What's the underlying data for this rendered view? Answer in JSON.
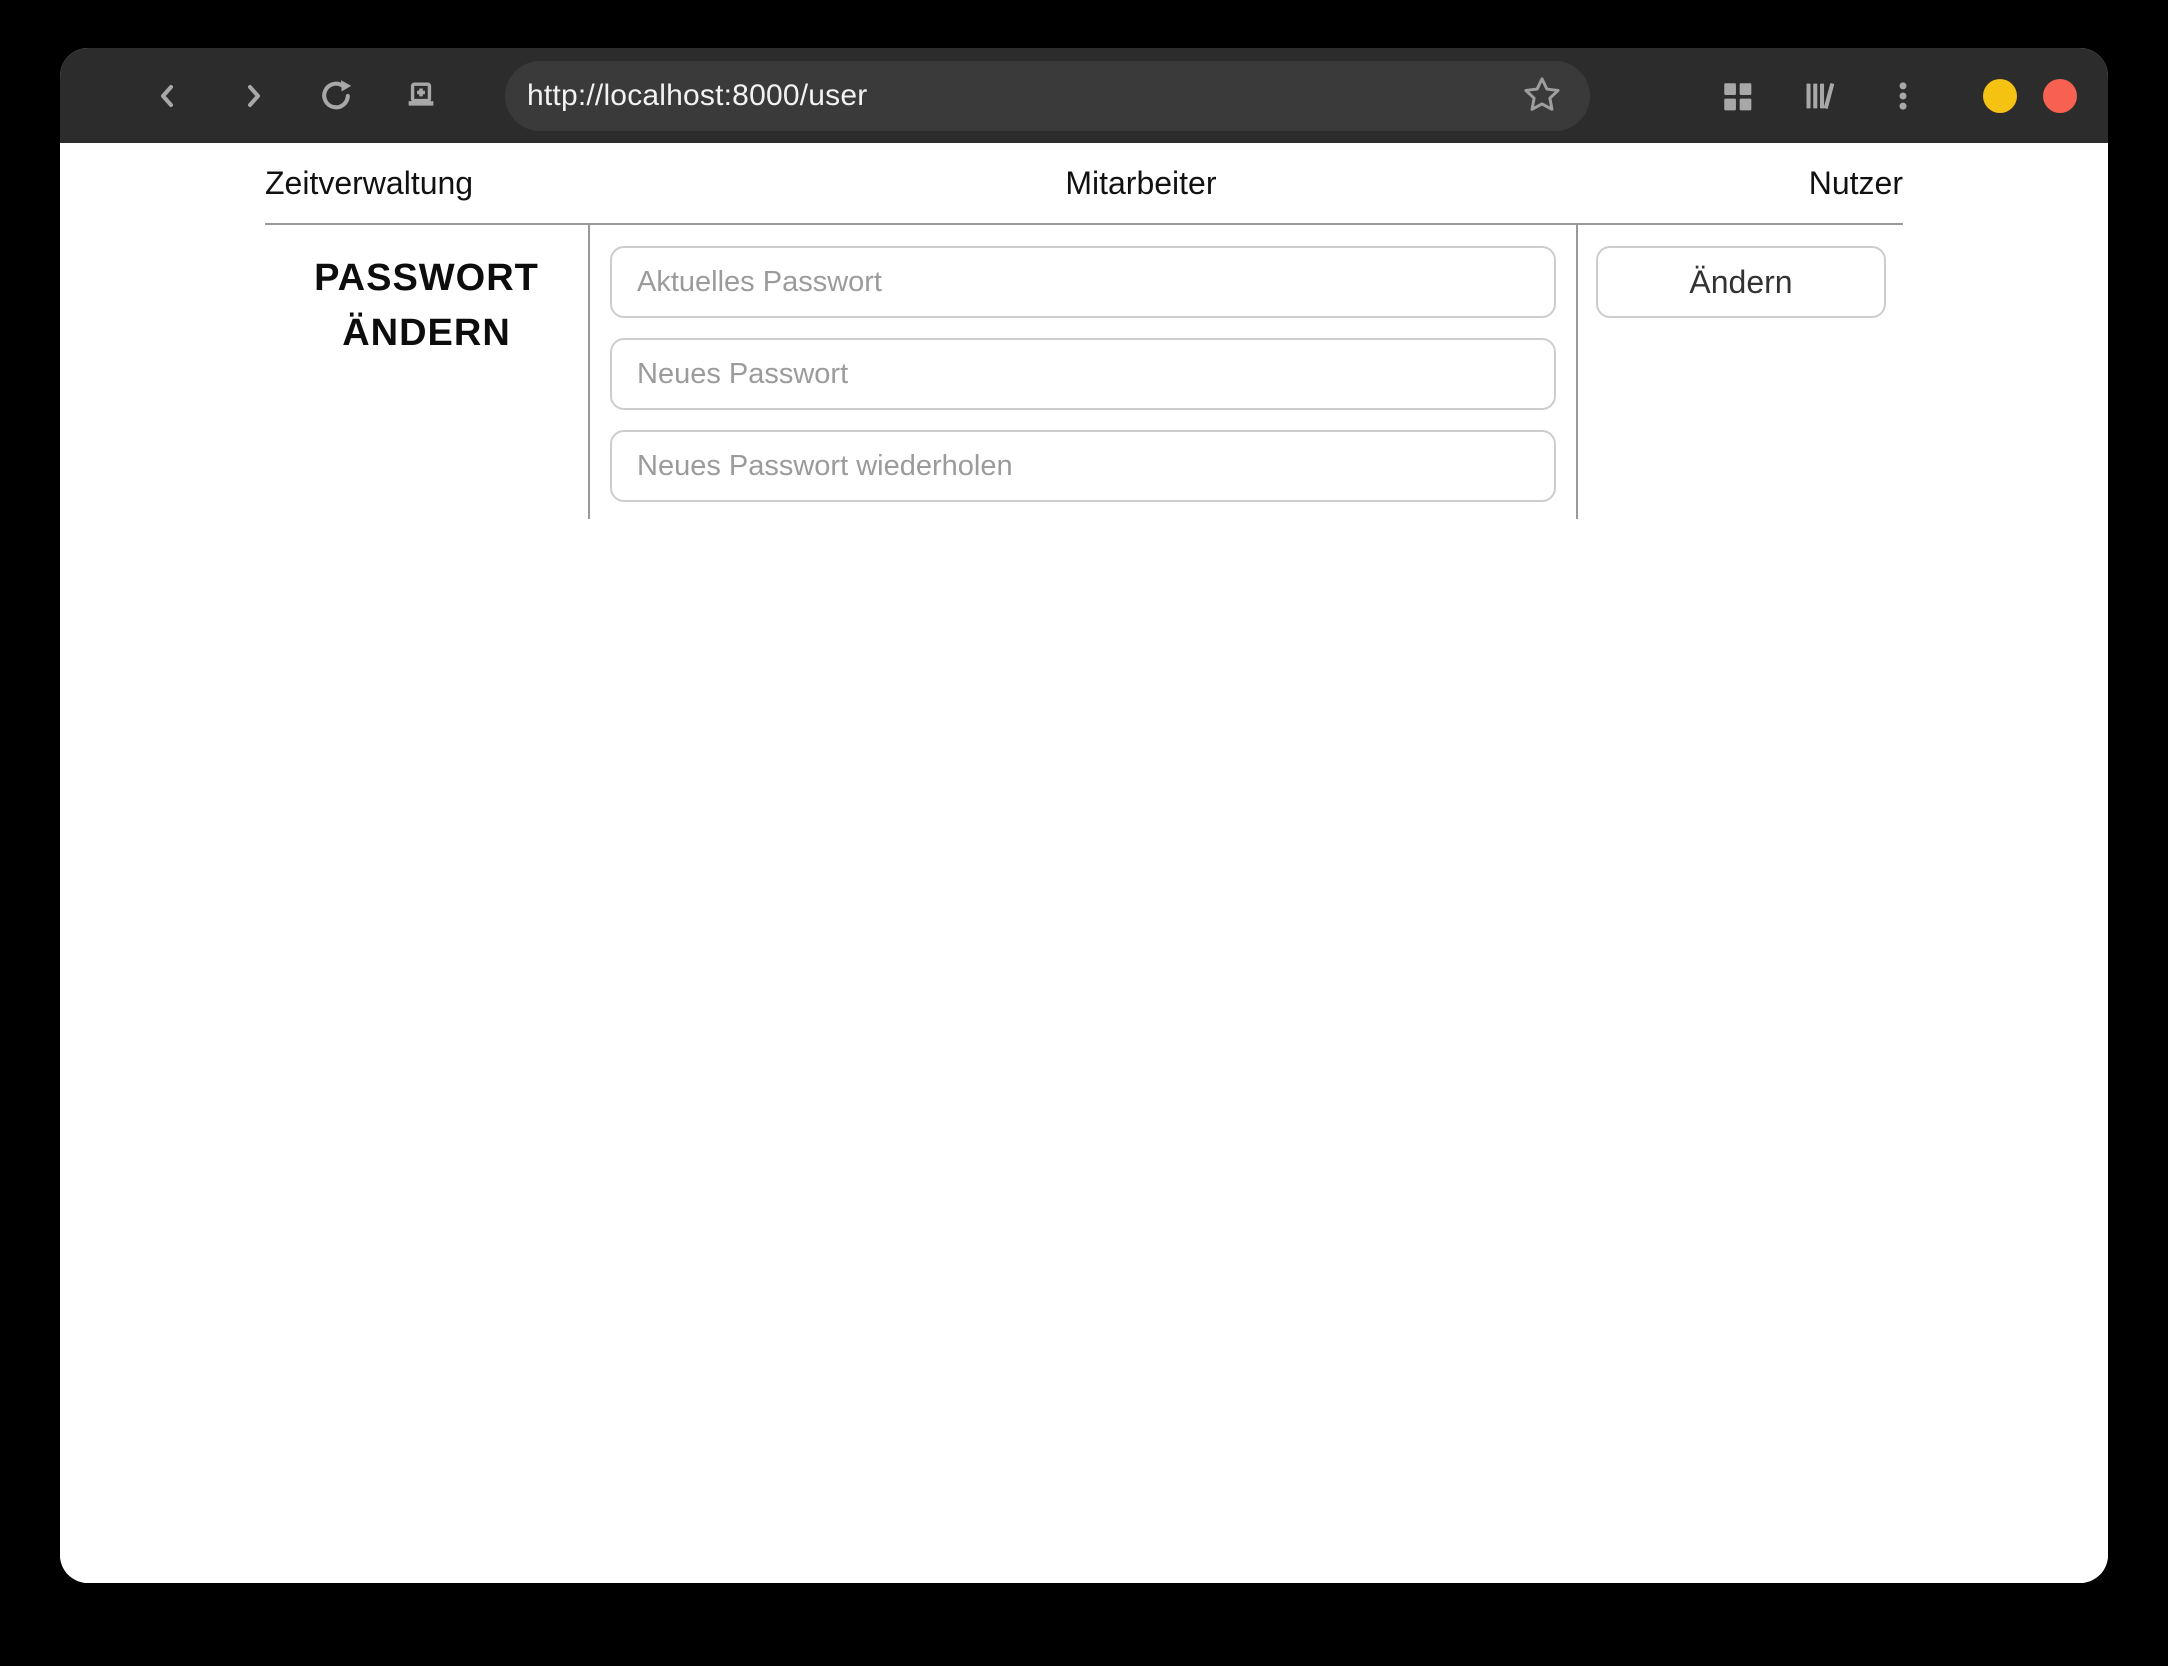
{
  "browser": {
    "url": "http://localhost:8000/user",
    "toolbar_icons": [
      "back",
      "forward",
      "reload",
      "new-tab",
      "bookmark-star",
      "extensions-grid",
      "library",
      "menu-kebab"
    ],
    "window_controls": [
      "minimize",
      "close"
    ],
    "colors": {
      "toolbar_bg": "#2c2c2c",
      "urlbar_bg": "#3a3a3a",
      "icon_gray": "#a8a8a8",
      "minimize_yellow": "#f5c211",
      "close_red": "#f66151"
    }
  },
  "page": {
    "nav": {
      "items": [
        {
          "label": "Zeitverwaltung"
        },
        {
          "label": "Mitarbeiter"
        },
        {
          "label": "Nutzer"
        }
      ]
    },
    "password_form": {
      "heading": "PASSWORT ÄNDERN",
      "fields": [
        {
          "placeholder": "Aktuelles Passwort",
          "value": ""
        },
        {
          "placeholder": "Neues Passwort",
          "value": ""
        },
        {
          "placeholder": "Neues Passwort wiederholen",
          "value": ""
        }
      ],
      "submit_label": "Ändern"
    }
  }
}
